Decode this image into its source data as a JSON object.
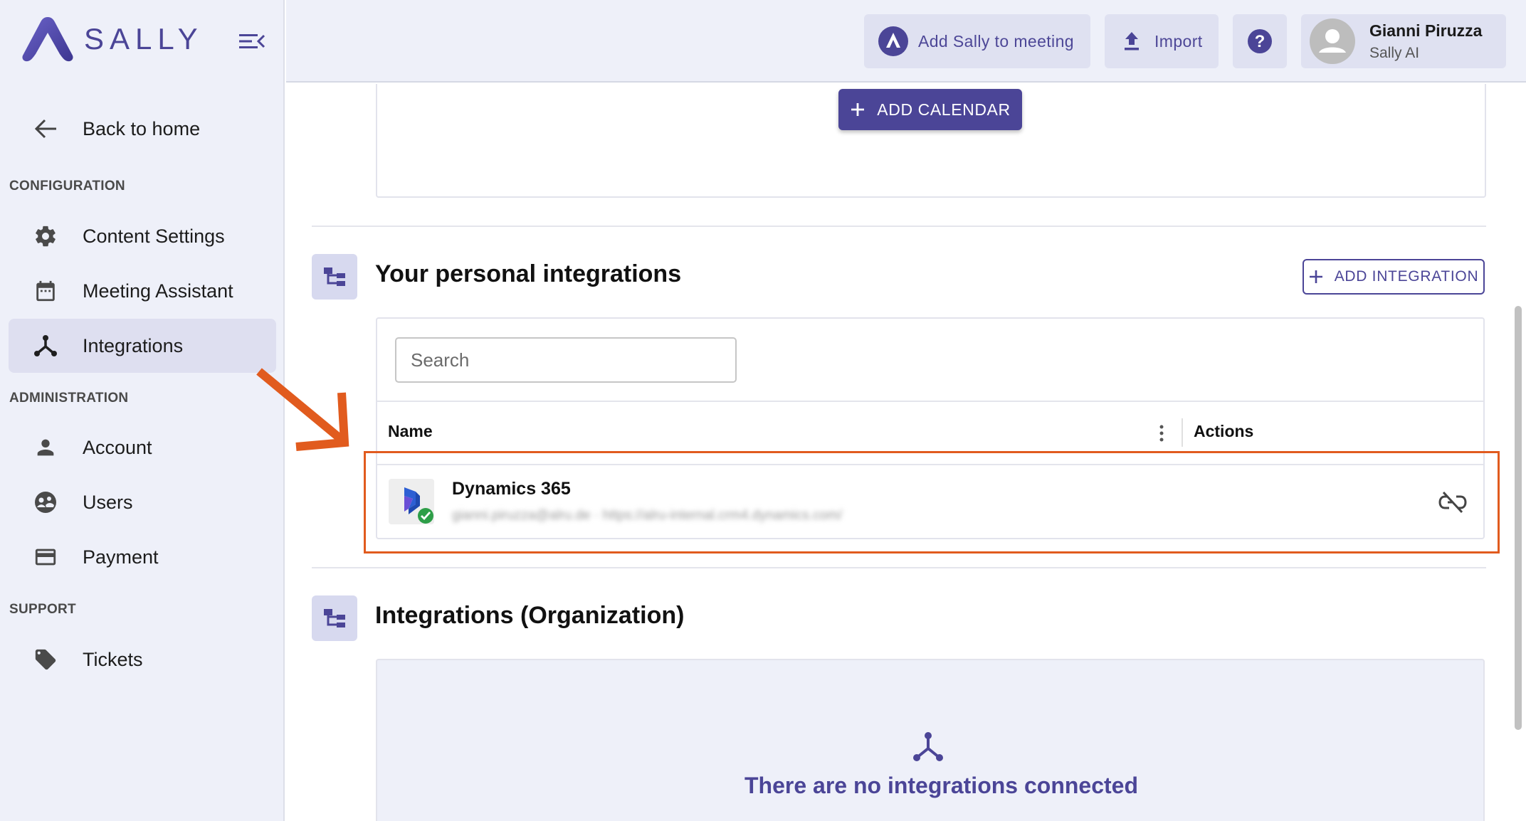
{
  "app": {
    "brand": "SALLY",
    "accent_color": "#4b4597"
  },
  "sidebar": {
    "back_label": "Back to home",
    "sections": {
      "configuration": "CONFIGURATION",
      "administration": "ADMINISTRATION",
      "support": "SUPPORT"
    },
    "items": [
      {
        "label": "Content Settings",
        "icon": "gear-icon"
      },
      {
        "label": "Meeting Assistant",
        "icon": "calendar-icon"
      },
      {
        "label": "Integrations",
        "icon": "integrations-icon",
        "active": true
      },
      {
        "label": "Account",
        "icon": "person-icon"
      },
      {
        "label": "Users",
        "icon": "users-icon"
      },
      {
        "label": "Payment",
        "icon": "credit-card-icon"
      },
      {
        "label": "Tickets",
        "icon": "tag-icon"
      }
    ]
  },
  "header": {
    "add_sally_label": "Add Sally to meeting",
    "import_label": "Import",
    "help_icon": "help-icon",
    "user": {
      "name": "Gianni Piruzza",
      "org": "Sally AI"
    }
  },
  "calendar": {
    "add_button_label": "ADD CALENDAR"
  },
  "personal_integrations": {
    "title": "Your personal integrations",
    "add_button_label": "ADD INTEGRATION",
    "search_placeholder": "Search",
    "columns": {
      "name": "Name",
      "actions": "Actions"
    },
    "rows": [
      {
        "name": "Dynamics 365",
        "status": "connected",
        "detail": "gianni.piruzza@alru.de · https://alru-internal.crm4.dynamics.com/"
      }
    ]
  },
  "org_integrations": {
    "title": "Integrations (Organization)",
    "empty_text": "There are no integrations connected"
  }
}
